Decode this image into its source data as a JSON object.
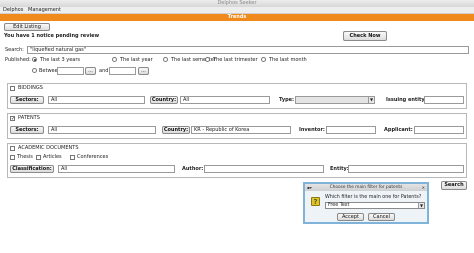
{
  "window": {
    "title": "Delphos Seeker"
  },
  "menu": {
    "items": [
      "Delphos",
      "Management"
    ],
    "hotkeys": [
      "D",
      "M"
    ]
  },
  "tab": {
    "title": "Trends"
  },
  "toolbar": {
    "edit_listing": "Edit Listing",
    "notice": "You have 1 notice pending review",
    "check_now": "Check Now"
  },
  "search": {
    "label": "Search:",
    "value": "\"liquefied natural gas\"",
    "button": "Search"
  },
  "published": {
    "label": "Published:",
    "options": [
      "The last 3 years",
      "The last year",
      "The last semester",
      "The last trimester",
      "The last month"
    ],
    "selected": "The last 3 years",
    "between_label": "Between",
    "and_label": "and",
    "picker": "..."
  },
  "biddings": {
    "heading": "BIDDINGS",
    "sectors_button": "Sectors:",
    "sectors_value": "All",
    "country_button": "Country:",
    "country_value": "All",
    "type_label": "Type:",
    "type_value": "",
    "issuing_label": "Issuing entity:",
    "issuing_value": ""
  },
  "patents": {
    "heading": "PATENTS",
    "checked": true,
    "sectors_button": "Sectors:",
    "sectors_value": "All",
    "country_button": "Country:",
    "country_value": "KR - Republic of Korea",
    "inventor_label": "Inventor:",
    "inventor_value": "",
    "applicant_label": "Applicant:",
    "applicant_value": ""
  },
  "academic": {
    "heading": "ACADEMIC DOCUMENTS",
    "kinds": [
      "Thesis",
      "Articles",
      "Conferences"
    ],
    "classification_button": "Classification:",
    "classification_value": "All",
    "author_label": "Author:",
    "author_value": "",
    "entity_label": "Entity:",
    "entity_value": ""
  },
  "dialog": {
    "title": "Choose the main filter for patents",
    "question": "Which filter is the main one for Patents?",
    "selected": "Free Text",
    "accept": "Accept",
    "cancel": "Cancel"
  },
  "colors": {
    "accent": "#f08a1c",
    "dialog_border": "#7fb3d9"
  }
}
